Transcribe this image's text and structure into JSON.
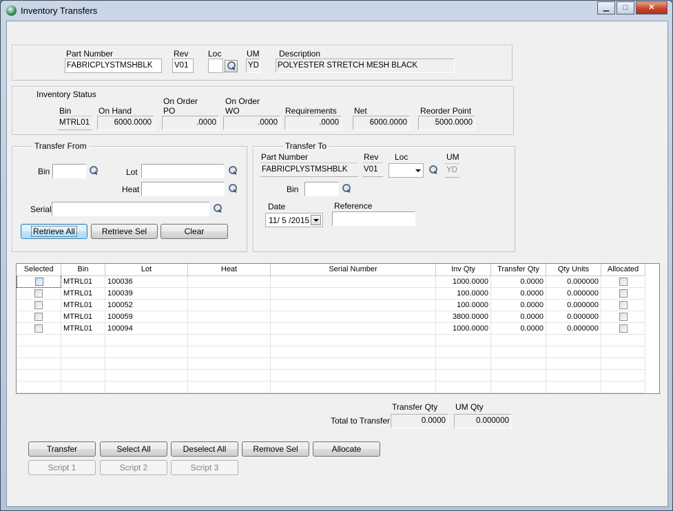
{
  "window": {
    "title": "Inventory Transfers",
    "min": "▁",
    "max": "□",
    "close": "✕"
  },
  "part": {
    "labels": {
      "part_number": "Part Number",
      "rev": "Rev",
      "loc": "Loc",
      "um": "UM",
      "description": "Description"
    },
    "part_number": "FABRICPLYSTMSHBLK",
    "rev": "V01",
    "loc": "",
    "um": "YD",
    "description": "POLYESTER STRETCH MESH BLACK"
  },
  "inventory_status": {
    "title": "Inventory Status",
    "labels": {
      "bin": "Bin",
      "on_hand": "On Hand",
      "on_order": "On Order",
      "po": "PO",
      "wo": "WO",
      "requirements": "Requirements",
      "net": "Net",
      "reorder_point": "Reorder Point"
    },
    "bin": "MTRL01",
    "on_hand": "6000.0000",
    "on_order_po": ".0000",
    "on_order_wo": ".0000",
    "requirements": ".0000",
    "net": "6000.0000",
    "reorder_point": "5000.0000"
  },
  "transfer_from": {
    "title": "Transfer From",
    "labels": {
      "bin": "Bin",
      "lot": "Lot",
      "heat": "Heat",
      "serial": "Serial"
    },
    "bin": "",
    "lot": "",
    "heat": "",
    "serial": "",
    "buttons": {
      "retrieve_all": "Retrieve All",
      "retrieve_sel": "Retrieve Sel",
      "clear": "Clear"
    }
  },
  "transfer_to": {
    "title": "Transfer To",
    "labels": {
      "part_number": "Part Number",
      "rev": "Rev",
      "loc": "Loc",
      "um": "UM",
      "bin": "Bin",
      "date": "Date",
      "reference": "Reference"
    },
    "part_number": "FABRICPLYSTMSHBLK",
    "rev": "V01",
    "loc": "",
    "um": "YD",
    "bin": "",
    "date": "11/ 5 /2015",
    "reference": ""
  },
  "grid": {
    "columns": [
      "Selected",
      "Bin",
      "Lot",
      "Heat",
      "Serial Number",
      "Inv Qty",
      "Transfer Qty",
      "Qty Units",
      "Allocated"
    ],
    "rows": [
      {
        "bin": "MTRL01",
        "lot": "100036",
        "heat": "",
        "serial": "",
        "inv_qty": "1000.0000",
        "transfer_qty": "0.0000",
        "qty_units": "0.000000"
      },
      {
        "bin": "MTRL01",
        "lot": "100039",
        "heat": "",
        "serial": "",
        "inv_qty": "100.0000",
        "transfer_qty": "0.0000",
        "qty_units": "0.000000"
      },
      {
        "bin": "MTRL01",
        "lot": "100052",
        "heat": "",
        "serial": "",
        "inv_qty": "100.0000",
        "transfer_qty": "0.0000",
        "qty_units": "0.000000"
      },
      {
        "bin": "MTRL01",
        "lot": "100059",
        "heat": "",
        "serial": "",
        "inv_qty": "3800.0000",
        "transfer_qty": "0.0000",
        "qty_units": "0.000000"
      },
      {
        "bin": "MTRL01",
        "lot": "100094",
        "heat": "",
        "serial": "",
        "inv_qty": "1000.0000",
        "transfer_qty": "0.0000",
        "qty_units": "0.000000"
      }
    ]
  },
  "totals": {
    "label": "Total to Transfer",
    "transfer_qty_label": "Transfer Qty",
    "um_qty_label": "UM Qty",
    "transfer_qty": "0.0000",
    "um_qty": "0.000000"
  },
  "actions": {
    "transfer": "Transfer",
    "select_all": "Select All",
    "deselect_all": "Deselect All",
    "remove_sel": "Remove Sel",
    "allocate": "Allocate",
    "script1": "Script 1",
    "script2": "Script 2",
    "script3": "Script 3"
  }
}
